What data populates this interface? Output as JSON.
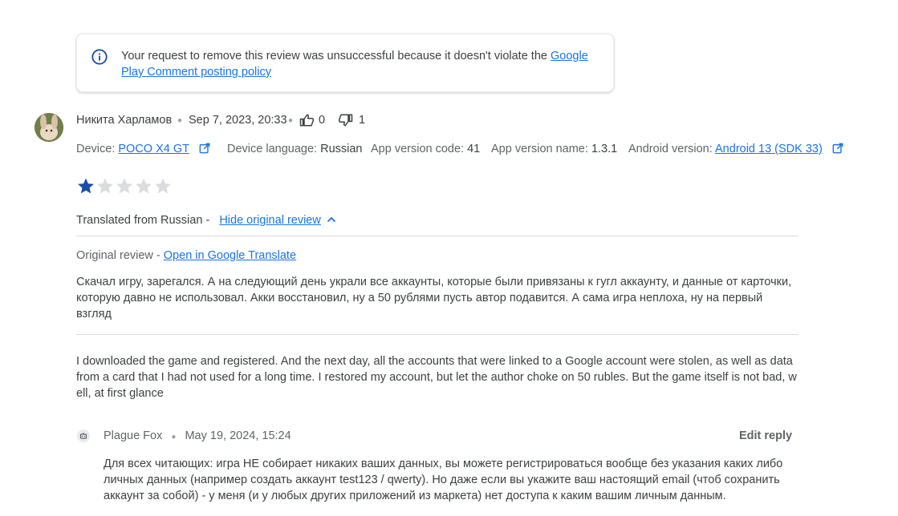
{
  "notice": {
    "text_prefix": "Your request to remove this review was unsuccessful because it doesn't violate the ",
    "link_label": "Google Play Comment posting policy",
    "icon": "info-icon"
  },
  "review": {
    "author": "Никита Харламов",
    "date": "Sep 7, 2023, 20:33",
    "thumbs_up_count": "0",
    "thumbs_down_count": "1",
    "rating": 1,
    "max_rating": 5,
    "device_label": "Device:",
    "device_value": "POCO X4 GT",
    "device_language_label": "Device language:",
    "device_language_value": "Russian",
    "app_version_code_label": "App version code:",
    "app_version_code_value": "41",
    "app_version_name_label": "App version name:",
    "app_version_name_value": "1.3.1",
    "android_version_label": "Android version:",
    "android_version_value": "Android 13 (SDK 33)",
    "translated_from": "Translated from Russian -",
    "hide_original_label": "Hide original review",
    "original_review_label": "Original review -",
    "open_translate_label": "Open in Google Translate",
    "original_text": "Скачал игру, зарегался. А на следующий день украли все аккаунты, которые были привязаны к гугл аккаунту, и данные от карточки, которую давно не использовал. Акки восстановил, ну а 50 рублями пусть автор подавится. А сама игра неплоха, ну на первый взгляд",
    "translated_text": "I downloaded the game and registered. And the next day, all the accounts that were linked to a Google account were stolen, as well as data from a card that I had not used for a long time. I restored my account, but let the author choke on 50 rubles. But the game itself is not bad, well, at first glance"
  },
  "reply": {
    "author": "Plague Fox",
    "date": "May 19, 2024, 15:24",
    "edit_label": "Edit reply",
    "text": "Для всех читающих: игра НЕ собирает никаких ваших данных, вы можете регистрироваться вообще без указания каких либо личных данных (например создать аккаунт test123 / qwerty). Но даже если вы укажите ваш настоящий email (чтоб сохранить аккаунт за собой) - у меня (и у любых других приложений из маркета) нет доступа к каким вашим личным данным."
  },
  "colors": {
    "star_filled": "#174ea6",
    "star_empty": "#dadce0",
    "link": "#1a73e8"
  }
}
